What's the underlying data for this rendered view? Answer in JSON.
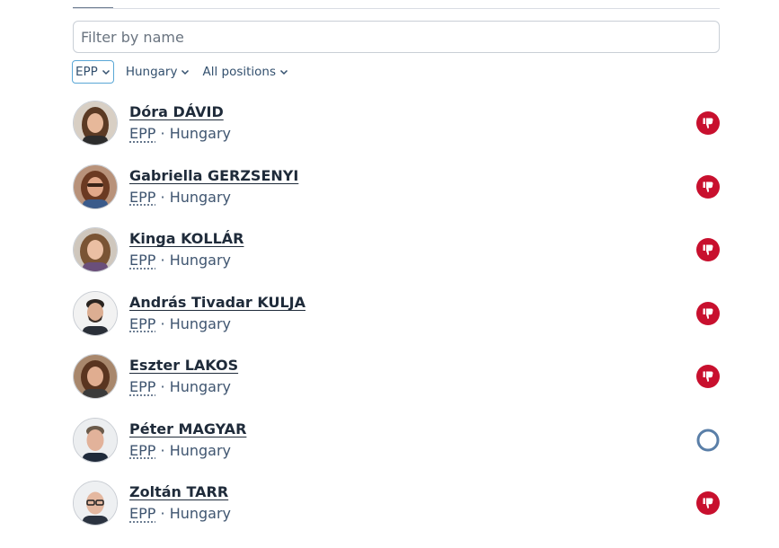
{
  "search": {
    "placeholder": "Filter by name",
    "value": ""
  },
  "filters": [
    {
      "label": "EPP",
      "active": true
    },
    {
      "label": "Hungary",
      "active": false
    },
    {
      "label": "All positions",
      "active": false
    }
  ],
  "members": [
    {
      "name": "Dóra DÁVID",
      "group": "EPP",
      "separator": "·",
      "country": "Hungary",
      "vote": "against",
      "vote_icon": "thumbs-down-icon"
    },
    {
      "name": "Gabriella GERZSENYI",
      "group": "EPP",
      "separator": "·",
      "country": "Hungary",
      "vote": "against",
      "vote_icon": "thumbs-down-icon"
    },
    {
      "name": "Kinga KOLLÁR",
      "group": "EPP",
      "separator": "·",
      "country": "Hungary",
      "vote": "against",
      "vote_icon": "thumbs-down-icon"
    },
    {
      "name": "András Tivadar KULJA",
      "group": "EPP",
      "separator": "·",
      "country": "Hungary",
      "vote": "against",
      "vote_icon": "thumbs-down-icon"
    },
    {
      "name": "Eszter LAKOS",
      "group": "EPP",
      "separator": "·",
      "country": "Hungary",
      "vote": "against",
      "vote_icon": "thumbs-down-icon"
    },
    {
      "name": "Péter MAGYAR",
      "group": "EPP",
      "separator": "·",
      "country": "Hungary",
      "vote": "did not vote",
      "vote_icon": "empty-circle-icon"
    },
    {
      "name": "Zoltán TARR",
      "group": "EPP",
      "separator": "·",
      "country": "Hungary",
      "vote": "against",
      "vote_icon": "thumbs-down-icon"
    }
  ],
  "colors": {
    "against": "#c8102e",
    "did_not_vote": "#5a7fa8",
    "focus": "#5aa7d6",
    "text": "#1f2b3a"
  }
}
